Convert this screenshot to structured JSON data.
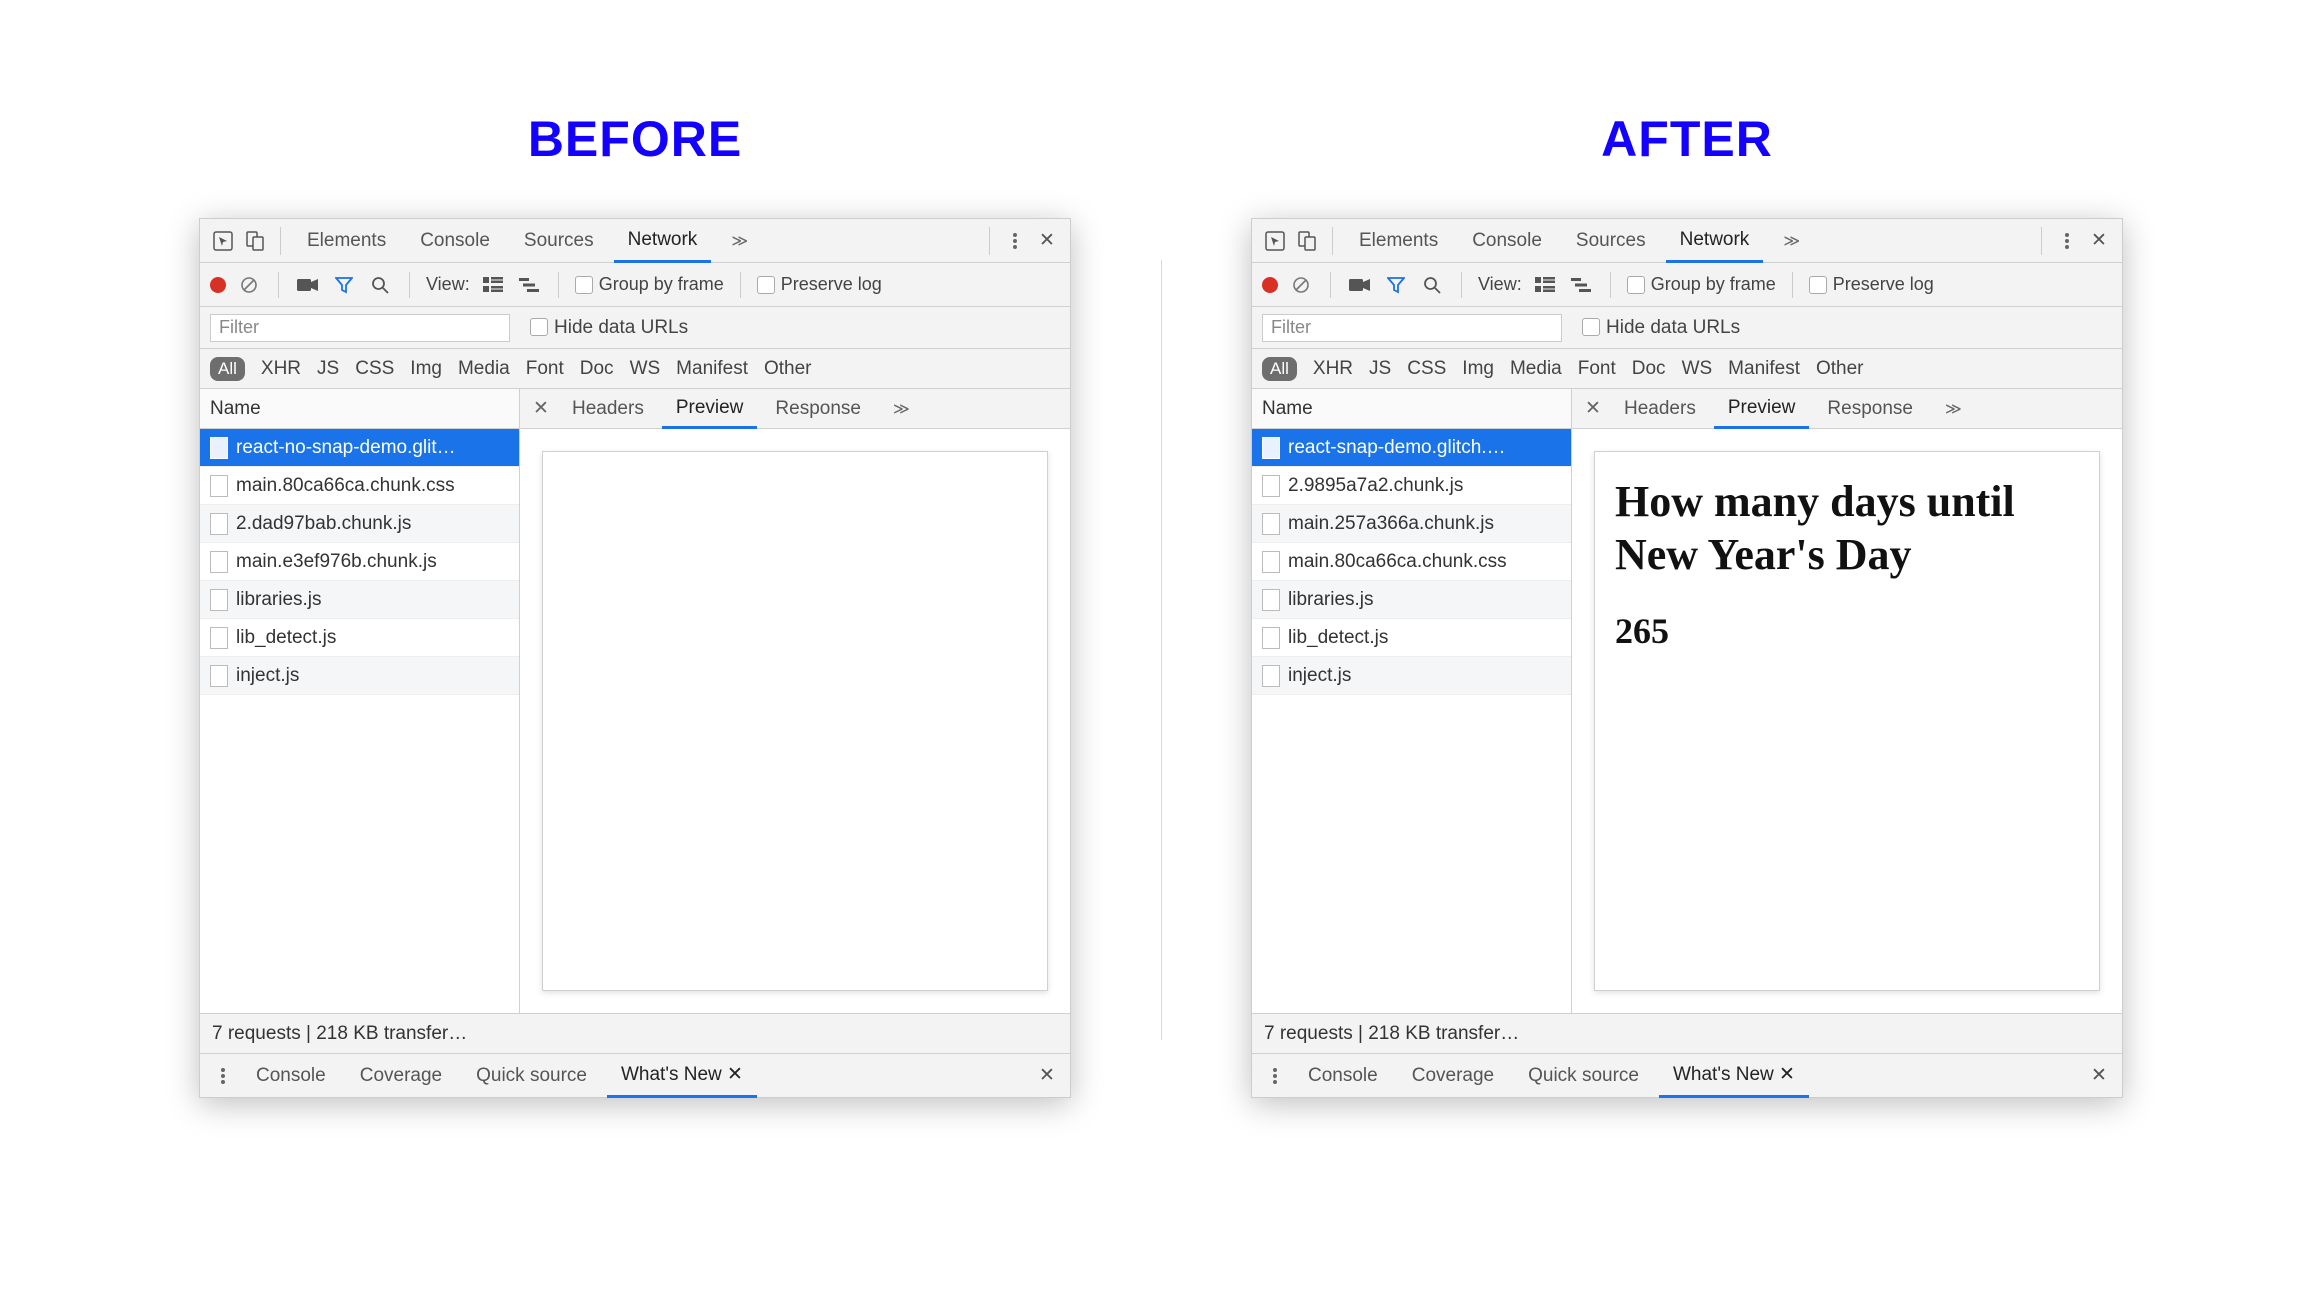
{
  "labels": {
    "before": "BEFORE",
    "after": "AFTER"
  },
  "top_tabs": {
    "elements": "Elements",
    "console": "Console",
    "sources": "Sources",
    "network": "Network"
  },
  "toolbar": {
    "view": "View:",
    "group_by_frame": "Group by frame",
    "preserve_log": "Preserve log"
  },
  "filter": {
    "placeholder": "Filter",
    "hide_data_urls": "Hide data URLs"
  },
  "types": {
    "all": "All",
    "xhr": "XHR",
    "js": "JS",
    "css": "CSS",
    "img": "Img",
    "media": "Media",
    "font": "Font",
    "doc": "Doc",
    "ws": "WS",
    "manifest": "Manifest",
    "other": "Other"
  },
  "columns": {
    "name": "Name"
  },
  "detail_tabs": {
    "headers": "Headers",
    "preview": "Preview",
    "response": "Response"
  },
  "status": "7 requests | 218 KB transfer…",
  "drawer": {
    "console": "Console",
    "coverage": "Coverage",
    "quick_source": "Quick source",
    "whats_new": "What's New"
  },
  "before": {
    "requests": [
      "react-no-snap-demo.glit…",
      "main.80ca66ca.chunk.css",
      "2.dad97bab.chunk.js",
      "main.e3ef976b.chunk.js",
      "libraries.js",
      "lib_detect.js",
      "inject.js"
    ],
    "preview_heading": "",
    "preview_value": ""
  },
  "after": {
    "requests": [
      "react-snap-demo.glitch.…",
      "2.9895a7a2.chunk.js",
      "main.257a366a.chunk.js",
      "main.80ca66ca.chunk.css",
      "libraries.js",
      "lib_detect.js",
      "inject.js"
    ],
    "preview_heading": "How many days until New Year's Day",
    "preview_value": "265"
  }
}
